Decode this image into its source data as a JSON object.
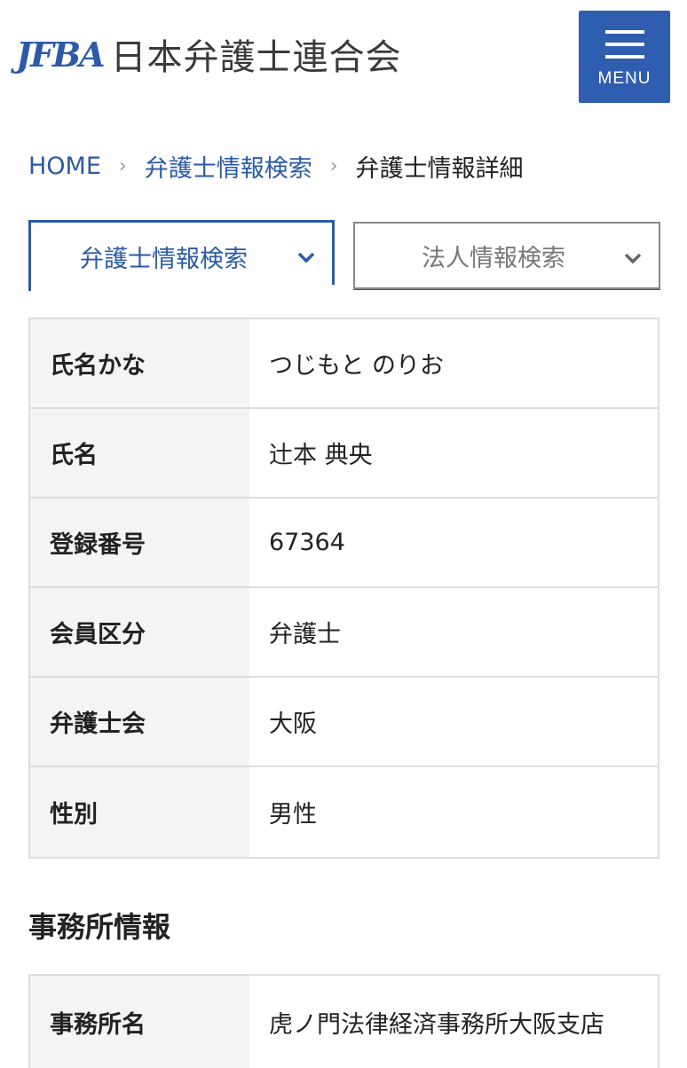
{
  "header": {
    "logo_mark": "JFBA",
    "logo_name": "日本弁護士連合会",
    "menu_label": "MENU"
  },
  "breadcrumb": {
    "home": "HOME",
    "search": "弁護士情報検索",
    "current": "弁護士情報詳細",
    "separator": "›"
  },
  "tabs": {
    "lawyer": "弁護士情報検索",
    "corporate": "法人情報検索"
  },
  "lawyer_info": [
    {
      "label": "氏名かな",
      "value": "つじもと のりお"
    },
    {
      "label": "氏名",
      "value": "辻本 典央"
    },
    {
      "label": "登録番号",
      "value": "67364"
    },
    {
      "label": "会員区分",
      "value": "弁護士"
    },
    {
      "label": "弁護士会",
      "value": "大阪"
    },
    {
      "label": "性別",
      "value": "男性"
    }
  ],
  "office": {
    "section_title": "事務所情報",
    "rows": [
      {
        "label": "事務所名",
        "value": "虎ノ門法律経済事務所大阪支店"
      }
    ]
  },
  "colors": {
    "brand_blue": "#2c5aa6",
    "menu_bg": "#2f5db0",
    "table_header_bg": "#f4f4f4",
    "border": "#dddddd"
  }
}
